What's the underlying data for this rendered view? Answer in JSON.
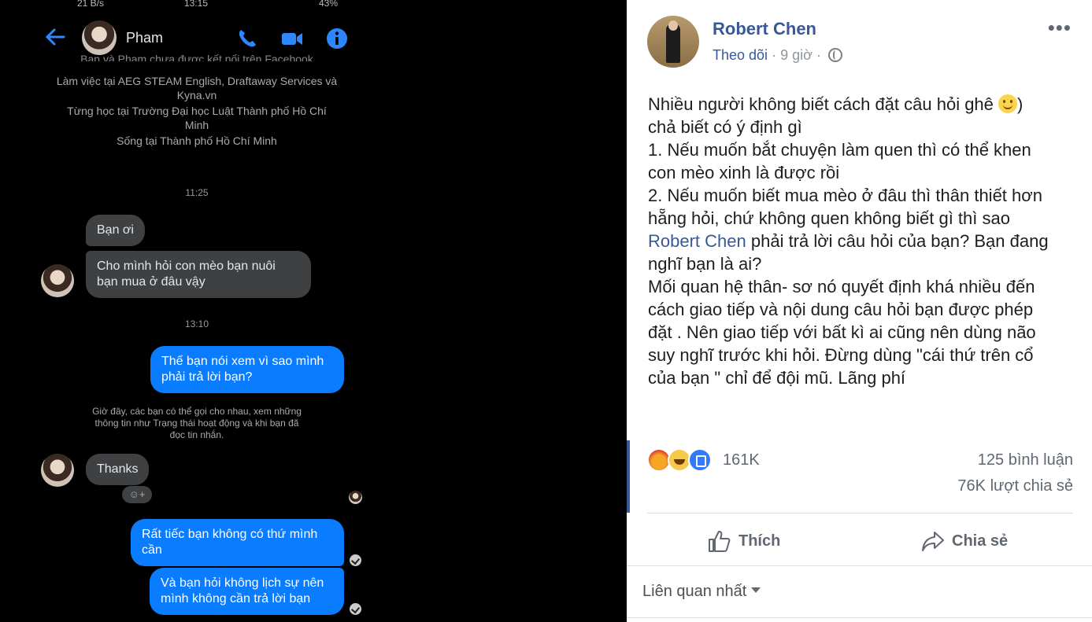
{
  "status_bar": {
    "speed": "21 B/s",
    "clock": "13:15",
    "battery": "43%"
  },
  "header": {
    "contact_name": "Pham",
    "icons": [
      "back-arrow-icon",
      "phone-icon",
      "video-camera-icon",
      "info-icon"
    ]
  },
  "profile_info": {
    "line_cut": "Bạn và Pham chưa được kết nối trên Facebook",
    "work": "Làm việc tại AEG STEAM English, Draftaway Services và",
    "work2": "Kyna.vn",
    "study": "Từng học tại Trường Đại học Luật Thành phố Hồ Chí",
    "study2": "Minh",
    "lives": "Sống tại Thành phố Hồ Chí Minh"
  },
  "messages": {
    "time1": "11:25",
    "m1": "Bạn ơi",
    "m2a": "Cho mình hỏi con mèo bạn nuôi",
    "m2b": "bạn mua ở đâu vậy",
    "time2": "13:10",
    "m3a": "Thế bạn nói xem vì sao mình",
    "m3b": "phải trả lời bạn?",
    "sys1": "Giờ đây, các bạn có thể gọi cho nhau, xem những",
    "sys2": "thông tin như Trạng thái hoạt động và khi bạn đã",
    "sys3": "đọc tin nhắn.",
    "m4": "Thanks",
    "m5a": "Rất tiếc bạn không có thứ mình",
    "m5b": "cần",
    "m6a": "Và bạn hỏi không lịch sự nên",
    "m6b": "mình không cần trả lời bạn"
  },
  "post": {
    "author": "Robert Chen",
    "follow": "Theo dõi",
    "time": "· 9 giờ ·",
    "more": "•••",
    "lines": {
      "l1": "Nhiều người không biết cách đặt câu hỏi ghê ",
      "l1end": ")",
      "l2": "chả biết có ý định gì",
      "l3": "1. Nếu muốn bắt chuyện làm quen thì có thể khen",
      "l4": "con mèo xinh là được rồi",
      "l5": "2. Nếu muốn biết mua mèo ở đâu thì thân thiết hơn",
      "l6": "hẵng hỏi, chứ không quen không biết gì thì sao",
      "l7mention": "Robert Chen",
      "l7": " phải trả lời câu hỏi của bạn? Bạn đang",
      "l8": "nghĩ bạn là ai?",
      "l9": "Mối quan hệ thân- sơ nó quyết định khá nhiều đến",
      "l10": "cách giao tiếp và nội dung câu hỏi bạn được phép",
      "l11": "đặt . Nên giao tiếp với bất kì ai cũng nên dùng não",
      "l12": "suy nghĩ trước khi hỏi. Đừng dùng \"cái thứ trên cổ",
      "l13": "của bạn \" chỉ để đội mũ. Lãng phí"
    },
    "reaction_count": "161K",
    "comments": "125 bình luận",
    "shares": "76K lượt chia sẻ",
    "like_label": "Thích",
    "share_label": "Chia sẻ",
    "sort_label": "Liên quan nhất"
  },
  "colors": {
    "messenger_blue": "#0a7cff",
    "fb_link": "#385898"
  }
}
